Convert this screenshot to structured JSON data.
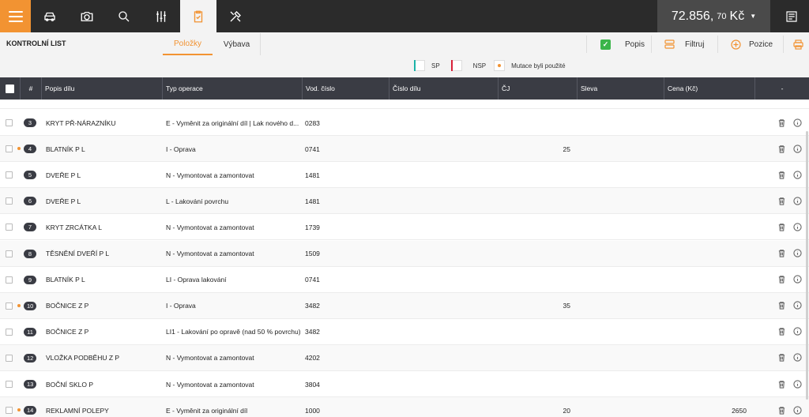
{
  "topbar": {
    "price_main": "72.856,",
    "price_decimals": "70",
    "price_currency": "Kč",
    "icons": [
      "menu-icon",
      "car-icon",
      "camera-icon",
      "search-icon",
      "sliders-icon",
      "clipboard-check-icon",
      "tools-icon",
      "document-icon"
    ]
  },
  "subheader": {
    "title": "KONTROLNÍ LIST",
    "tabs": [
      {
        "label": "Položky",
        "active": true
      },
      {
        "label": "Výbava",
        "active": false
      }
    ],
    "tools": {
      "popis": "Popis",
      "filtruj": "Filtruj",
      "pozice": "Pozice"
    },
    "legend": {
      "sp": "SP",
      "nsp": "NSP",
      "mutace": "Mutace byli použité"
    }
  },
  "table": {
    "columns": [
      "#",
      "Popis dílu",
      "Typ operace",
      "Vod. číslo",
      "Číslo dílu",
      "ČJ",
      "Sleva",
      "Cena (Kč)",
      "-"
    ],
    "rows": [
      {
        "num": "3",
        "popis": "KRYT PŘ-NÁRAZNÍKU",
        "typ": "E - Vyměnit za originální díl | Lak nového d...",
        "vod": "0283",
        "cj": "",
        "cena": "",
        "dot": false
      },
      {
        "num": "4",
        "popis": "BLATNÍK P L",
        "typ": "I - Oprava",
        "vod": "0741",
        "cj": "25",
        "cena": "",
        "dot": true
      },
      {
        "num": "5",
        "popis": "DVEŘE P L",
        "typ": "N - Vymontovat a zamontovat",
        "vod": "1481",
        "cj": "",
        "cena": "",
        "dot": false
      },
      {
        "num": "6",
        "popis": "DVEŘE P L",
        "typ": "L - Lakování povrchu",
        "vod": "1481",
        "cj": "",
        "cena": "",
        "dot": false
      },
      {
        "num": "7",
        "popis": "KRYT ZRCÁTKA L",
        "typ": "N - Vymontovat a zamontovat",
        "vod": "1739",
        "cj": "",
        "cena": "",
        "dot": false
      },
      {
        "num": "8",
        "popis": "TĚSNĚNÍ DVEŘÍ P L",
        "typ": "N - Vymontovat a zamontovat",
        "vod": "1509",
        "cj": "",
        "cena": "",
        "dot": false
      },
      {
        "num": "9",
        "popis": "BLATNÍK P L",
        "typ": "LI - Oprava lakování",
        "vod": "0741",
        "cj": "",
        "cena": "",
        "dot": false
      },
      {
        "num": "10",
        "popis": "BOČNICE Z P",
        "typ": "I - Oprava",
        "vod": "3482",
        "cj": "35",
        "cena": "",
        "dot": true
      },
      {
        "num": "11",
        "popis": "BOČNICE Z P",
        "typ": "LI1 - Lakování po opravě (nad 50 % povrchu)",
        "vod": "3482",
        "cj": "",
        "cena": "",
        "dot": false
      },
      {
        "num": "12",
        "popis": "VLOŽKA PODBĚHU Z P",
        "typ": "N - Vymontovat a zamontovat",
        "vod": "4202",
        "cj": "",
        "cena": "",
        "dot": false
      },
      {
        "num": "13",
        "popis": "BOČNÍ SKLO P",
        "typ": "N - Vymontovat a zamontovat",
        "vod": "3804",
        "cj": "",
        "cena": "",
        "dot": false
      },
      {
        "num": "14",
        "popis": "REKLAMNÍ POLEPY",
        "typ": "E - Vyměnit za originální díl",
        "vod": "1000",
        "cj": "20",
        "cena": "2650",
        "dot": true
      }
    ]
  },
  "colors": {
    "accent": "#f29332",
    "topbar": "#2b2b2b",
    "header": "#3a3c44",
    "sp": "#1cb3a8",
    "nsp": "#d9223a",
    "check": "#3bb54a"
  }
}
